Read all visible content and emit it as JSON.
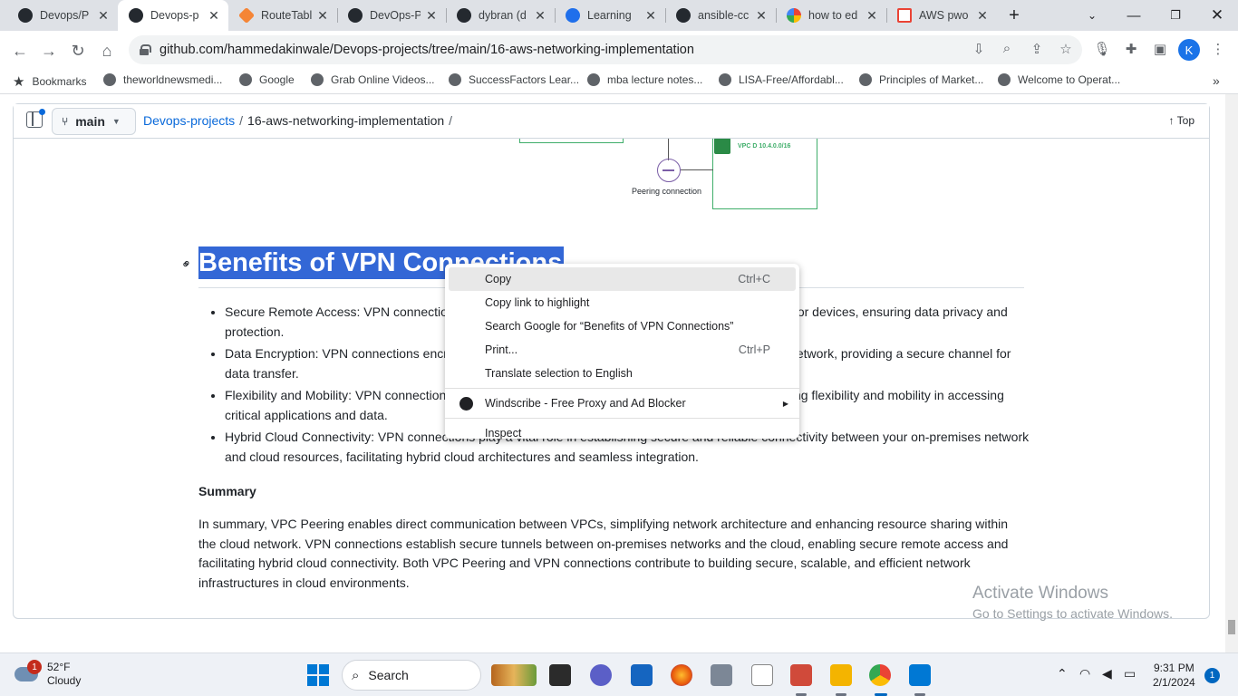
{
  "browser": {
    "tabs": [
      {
        "title": "Devops/P",
        "icon": "github-icon"
      },
      {
        "title": "Devops-p",
        "icon": "github-icon",
        "active": true
      },
      {
        "title": "RouteTabl",
        "icon": "aws-icon"
      },
      {
        "title": "DevOps-P",
        "icon": "github-icon"
      },
      {
        "title": "dybran (d",
        "icon": "github-icon"
      },
      {
        "title": "Learning",
        "icon": "learning-icon"
      },
      {
        "title": "ansible-cc",
        "icon": "github-icon"
      },
      {
        "title": "how to ed",
        "icon": "google-icon"
      },
      {
        "title": "AWS pwo",
        "icon": "gmail-icon"
      }
    ],
    "url": "github.com/hammedakinwale/Devops-projects/tree/main/16-aws-networking-implementation",
    "profile_initial": "K",
    "bookmarks": [
      "Bookmarks",
      "theworldnewsmedi...",
      "Google",
      "Grab Online Videos...",
      "SuccessFactors Lear...",
      "mba lecture notes...",
      "LISA-Free/Affordabl...",
      "Principles of Market...",
      "Welcome to Operat..."
    ]
  },
  "github": {
    "branch": "main",
    "breadcrumb_repo": "Devops-projects",
    "breadcrumb_folder": "16-aws-networking-implementation",
    "breadcrumb_sep": "/",
    "top_label": "Top"
  },
  "diagram": {
    "vpc_label": "VPC D 10.4.0.0/16",
    "peering_label": "Peering connection"
  },
  "article": {
    "heading": "Benefits of VPN Connections",
    "bullets": [
      "Secure Remote Access: VPN connections provide secure access to cloud resources for remote users or devices, ensuring data privacy and protection.",
      "Data Encryption: VPN connections encrypt data traffic between on-premises networks and the cloud network, providing a secure channel for data transfer.",
      "Flexibility and Mobility: VPN connections enable access to cloud resources from any location, promoting flexibility and mobility in accessing critical applications and data.",
      "Hybrid Cloud Connectivity: VPN connections play a vital role in establishing secure and reliable connectivity between your on-premises network and cloud resources, facilitating hybrid cloud architectures and seamless integration."
    ],
    "summary_heading": "Summary",
    "summary_text": "In summary, VPC Peering enables direct communication between VPCs, simplifying network architecture and enhancing resource sharing within the cloud network. VPN connections establish secure tunnels between on-premises networks and the cloud, enabling secure remote access and facilitating hybrid cloud connectivity. Both VPC Peering and VPN connections contribute to building secure, scalable, and efficient network infrastructures in cloud environments."
  },
  "context_menu": {
    "copy": "Copy",
    "copy_shortcut": "Ctrl+C",
    "copy_link": "Copy link to highlight",
    "search_google": "Search Google for “Benefits of VPN Connections”",
    "print": "Print...",
    "print_shortcut": "Ctrl+P",
    "translate": "Translate selection to English",
    "windscribe": "Windscribe - Free Proxy and Ad Blocker",
    "inspect": "Inspect"
  },
  "watermark": {
    "line1": "Activate Windows",
    "line2": "Go to Settings to activate Windows."
  },
  "taskbar": {
    "temperature": "52°F",
    "condition": "Cloudy",
    "weather_badge": "1",
    "search_label": "Search",
    "time": "9:31 PM",
    "date": "2/1/2024",
    "notification_count": "1"
  }
}
